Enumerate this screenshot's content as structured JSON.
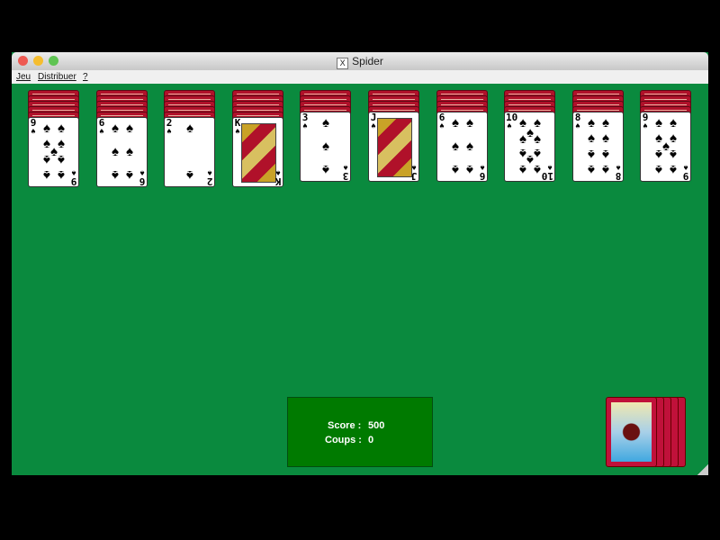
{
  "window": {
    "title": "Spider",
    "traffic_lights": [
      "#ee5a52",
      "#f5bd2f",
      "#5fc453"
    ]
  },
  "menu": [
    "Jeu",
    "Distribuer",
    "?"
  ],
  "columns": [
    {
      "hidden": 5,
      "rank": "9",
      "count": 9
    },
    {
      "hidden": 5,
      "rank": "6",
      "count": 6
    },
    {
      "hidden": 5,
      "rank": "2",
      "count": 2
    },
    {
      "hidden": 5,
      "rank": "K",
      "count": 0
    },
    {
      "hidden": 4,
      "rank": "3",
      "count": 3
    },
    {
      "hidden": 4,
      "rank": "J",
      "count": 0
    },
    {
      "hidden": 4,
      "rank": "6",
      "count": 6
    },
    {
      "hidden": 4,
      "rank": "10",
      "count": 10
    },
    {
      "hidden": 4,
      "rank": "8",
      "count": 8
    },
    {
      "hidden": 4,
      "rank": "9",
      "count": 9
    }
  ],
  "suit": "spade",
  "status": {
    "score_label": "Score :",
    "score": "500",
    "moves_label": "Coups :",
    "moves": "0"
  },
  "stock_deals": 5,
  "colors": {
    "felt": "#0a8a3e",
    "card_back": "#b0112a",
    "score_box": "#007a00"
  }
}
